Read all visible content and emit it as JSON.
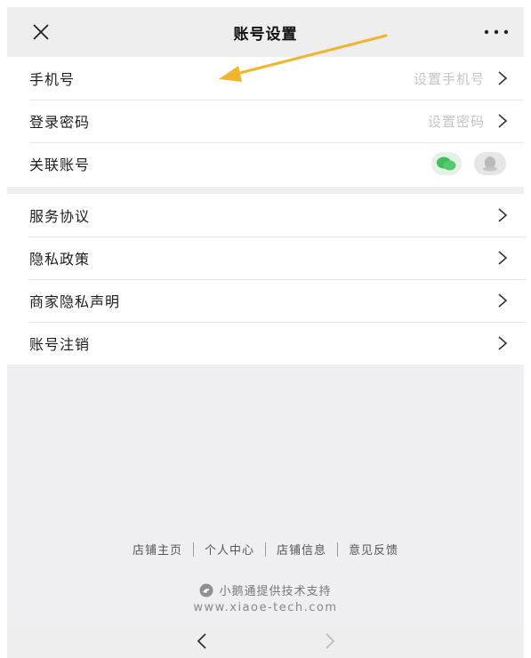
{
  "header": {
    "title": "账号设置",
    "close_icon": "close-icon",
    "more_icon": "more-icon"
  },
  "account_group": {
    "rows": [
      {
        "label": "手机号",
        "value": "设置手机号"
      },
      {
        "label": "登录密码",
        "value": "设置密码"
      },
      {
        "label": "关联账号",
        "icons": [
          "wechat-icon",
          "qq-icon"
        ]
      }
    ]
  },
  "policy_group": {
    "rows": [
      {
        "label": "服务协议"
      },
      {
        "label": "隐私政策"
      },
      {
        "label": "商家隐私声明"
      },
      {
        "label": "账号注销"
      }
    ]
  },
  "footer": {
    "links": [
      "店铺主页",
      "个人中心",
      "店铺信息",
      "意见反馈"
    ],
    "powered_by": "小鹅通提供技术支持",
    "site": "www.xiaoe-tech.com"
  },
  "colors": {
    "wechat": "#3fbf5a",
    "arrow": "#f0b52c",
    "placeholder": "#c4c4c4"
  }
}
